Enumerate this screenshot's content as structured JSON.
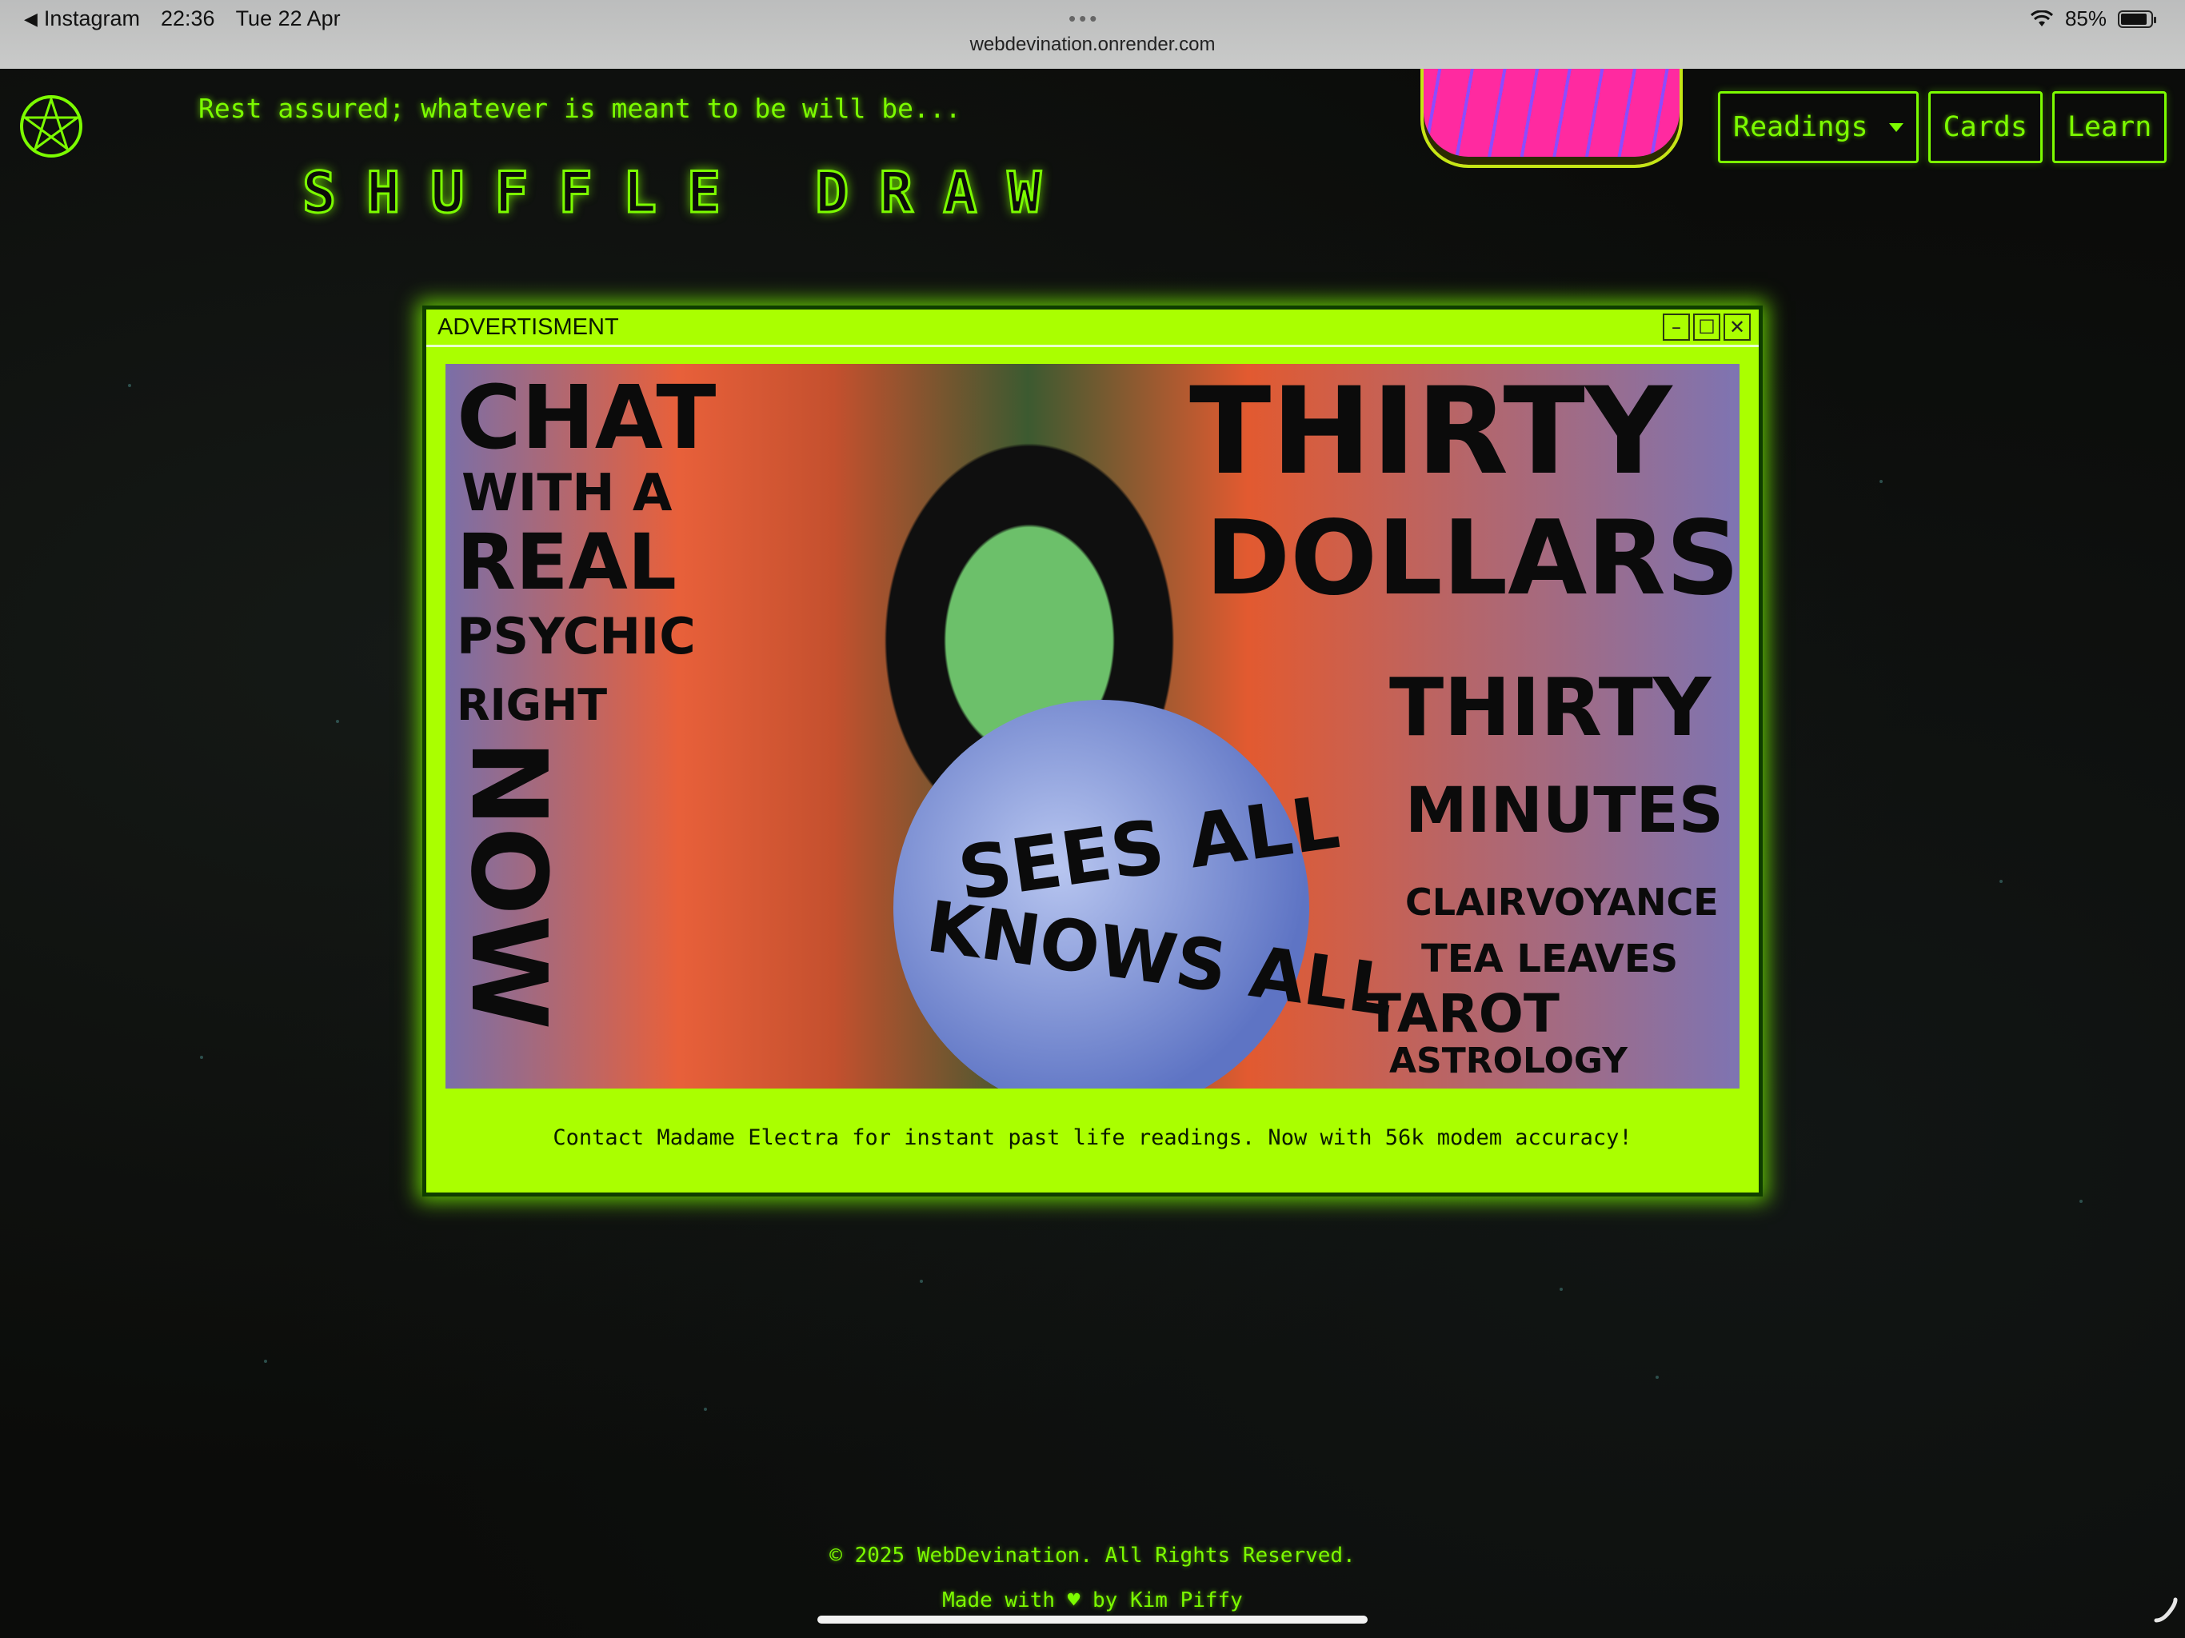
{
  "status_bar": {
    "back_app": "Instagram",
    "time": "22:36",
    "date": "Tue 22 Apr",
    "url": "webdevination.onrender.com",
    "battery": "85%",
    "battery_level": 0.85
  },
  "header": {
    "tagline": "Rest assured; whatever is meant to be will be...",
    "title": "SHUFFLE DRAW"
  },
  "nav": {
    "readings": "Readings",
    "cards": "Cards",
    "learn": "Learn"
  },
  "ad": {
    "window_title": "ADVERTISMENT",
    "minimize": "–",
    "maximize": "☐",
    "close": "✕",
    "image_text": {
      "chat": "CHAT",
      "with_a": "WITH A",
      "real": "REAL",
      "psychic": "PSYCHIC",
      "right": "RIGHT",
      "now": "NOW",
      "thirty_1": "THIRTY",
      "dollars": "DOLLARS",
      "thirty_2": "THIRTY",
      "minutes": "MINUTES",
      "clairvoyance": "CLAIRVOYANCE",
      "tea_leaves": "TEA LEAVES",
      "tarot": "TAROT",
      "astrology": "ASTROLOGY",
      "sees_all": "SEES ALL",
      "knows_all": "KNOWS ALL"
    },
    "caption": "Contact Madame Electra for instant past life readings. Now with 56k modem accuracy!"
  },
  "footer": {
    "copyright": "© 2025 WebDevination. All Rights Reserved.",
    "made_with_prefix": "Made with",
    "made_with_suffix": "by Kim Piffy"
  },
  "colors": {
    "neon_green": "#7cfc00",
    "ad_background": "#aaff00",
    "page_background": "#0b0c0a"
  }
}
